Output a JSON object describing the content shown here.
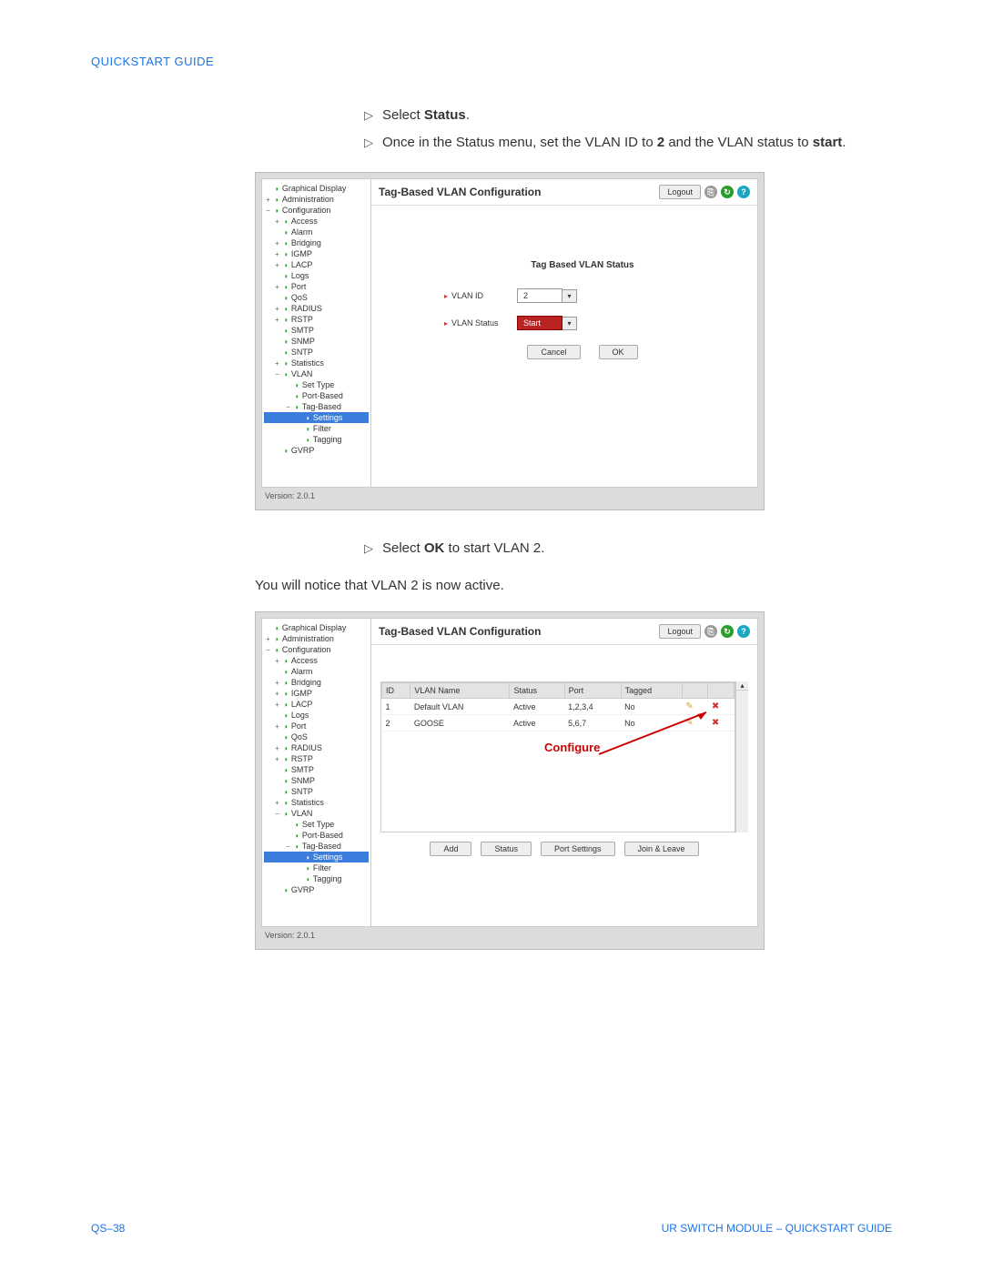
{
  "header": {
    "title": "QUICKSTART GUIDE"
  },
  "instructions_top": [
    {
      "pre": "Select ",
      "bold": "Status",
      "post": "."
    },
    {
      "pre": "Once in the Status menu, set the VLAN ID to ",
      "bold": "2",
      "mid": " and the VLAN status to ",
      "bold2": "start",
      "post": "."
    }
  ],
  "instructions_mid": [
    {
      "pre": "Select ",
      "bold": "OK",
      "post": " to start VLAN 2."
    }
  ],
  "body_text": "You will notice that VLAN 2 is now active.",
  "tree": {
    "items": [
      {
        "exp": "",
        "ind": "",
        "label": "Graphical Display"
      },
      {
        "exp": "+",
        "ind": "",
        "label": "Administration"
      },
      {
        "exp": "−",
        "ind": "",
        "label": "Configuration"
      },
      {
        "exp": "+",
        "ind": "ind1",
        "label": "Access"
      },
      {
        "exp": "",
        "ind": "ind1",
        "label": "Alarm"
      },
      {
        "exp": "+",
        "ind": "ind1",
        "label": "Bridging"
      },
      {
        "exp": "+",
        "ind": "ind1",
        "label": "IGMP"
      },
      {
        "exp": "+",
        "ind": "ind1",
        "label": "LACP"
      },
      {
        "exp": "",
        "ind": "ind1",
        "label": "Logs"
      },
      {
        "exp": "+",
        "ind": "ind1",
        "label": "Port"
      },
      {
        "exp": "",
        "ind": "ind1",
        "label": "QoS"
      },
      {
        "exp": "+",
        "ind": "ind1",
        "label": "RADIUS"
      },
      {
        "exp": "+",
        "ind": "ind1",
        "label": "RSTP"
      },
      {
        "exp": "",
        "ind": "ind1",
        "label": "SMTP"
      },
      {
        "exp": "",
        "ind": "ind1",
        "label": "SNMP"
      },
      {
        "exp": "",
        "ind": "ind1",
        "label": "SNTP"
      },
      {
        "exp": "+",
        "ind": "ind1",
        "label": "Statistics"
      },
      {
        "exp": "−",
        "ind": "ind1",
        "label": "VLAN"
      },
      {
        "exp": "",
        "ind": "ind2",
        "label": "Set Type"
      },
      {
        "exp": "",
        "ind": "ind2",
        "label": "Port-Based"
      },
      {
        "exp": "−",
        "ind": "ind2",
        "label": "Tag-Based"
      },
      {
        "exp": "",
        "ind": "ind3",
        "label": "Settings",
        "sel": true
      },
      {
        "exp": "",
        "ind": "ind3",
        "label": "Filter"
      },
      {
        "exp": "",
        "ind": "ind3",
        "label": "Tagging"
      },
      {
        "exp": "",
        "ind": "ind1",
        "label": "GVRP"
      }
    ]
  },
  "shot1": {
    "title": "Tag-Based VLAN Configuration",
    "logout": "Logout",
    "form_title": "Tag Based VLAN Status",
    "vlan_id_label": "VLAN ID",
    "vlan_id_value": "2",
    "vlan_status_label": "VLAN Status",
    "vlan_status_value": "Start",
    "cancel": "Cancel",
    "ok": "OK",
    "version": "Version: 2.0.1"
  },
  "shot2": {
    "title": "Tag-Based VLAN Configuration",
    "logout": "Logout",
    "columns": {
      "id": "ID",
      "name": "VLAN Name",
      "status": "Status",
      "port": "Port",
      "tagged": "Tagged"
    },
    "rows": [
      {
        "id": "1",
        "name": "Default VLAN",
        "status": "Active",
        "port": "1,2,3,4",
        "tagged": "No"
      },
      {
        "id": "2",
        "name": "GOOSE",
        "status": "Active",
        "port": "5,6,7",
        "tagged": "No"
      }
    ],
    "annot": "Configure",
    "buttons": {
      "add": "Add",
      "status": "Status",
      "port": "Port Settings",
      "join": "Join & Leave"
    },
    "version": "Version: 2.0.1"
  },
  "footer": {
    "page": "QS–38",
    "title": "UR SWITCH MODULE – QUICKSTART GUIDE"
  }
}
